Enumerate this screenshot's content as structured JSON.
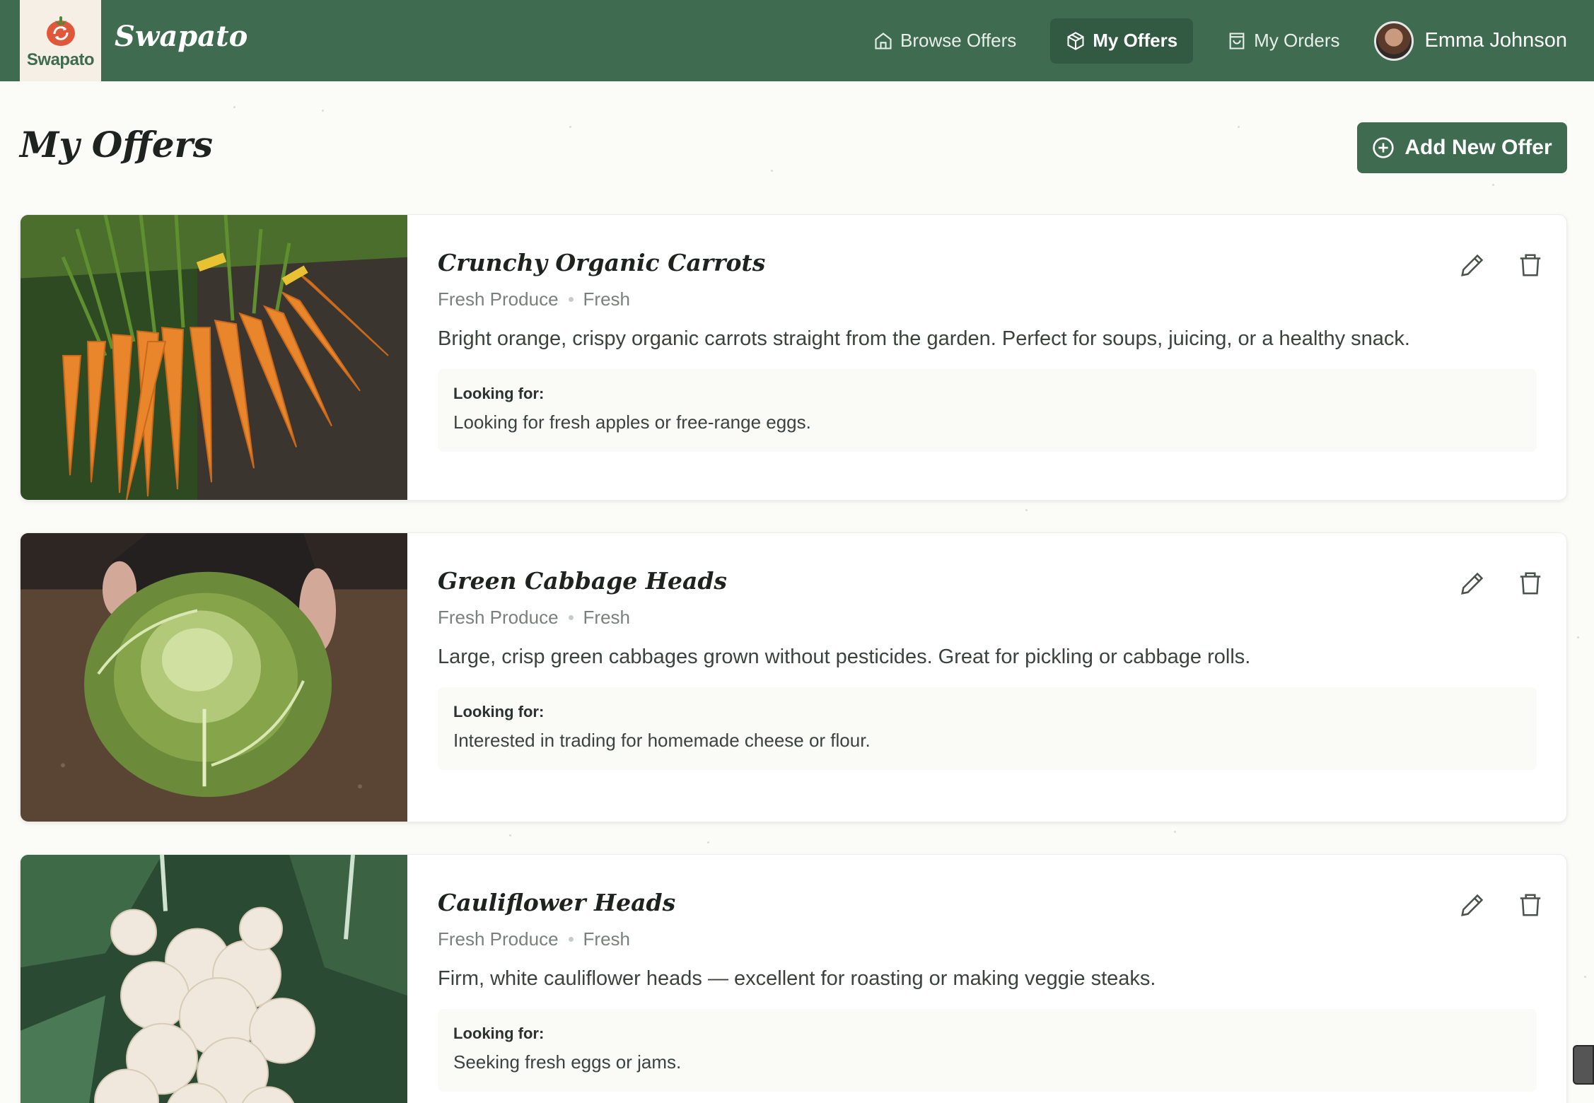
{
  "app": {
    "logo_text": "Swapato",
    "brand": "Swapato"
  },
  "nav": {
    "items": [
      {
        "label": "Browse Offers",
        "icon": "home-icon",
        "active": false
      },
      {
        "label": "My Offers",
        "icon": "package-icon",
        "active": true
      },
      {
        "label": "My Orders",
        "icon": "shopping-bag-icon",
        "active": false
      }
    ],
    "user_name": "Emma Johnson"
  },
  "page": {
    "title": "My Offers",
    "add_button_label": "Add New Offer"
  },
  "offers": [
    {
      "title": "Crunchy Organic Carrots",
      "category": "Fresh Produce",
      "condition": "Fresh",
      "description": "Bright orange, crispy organic carrots straight from the garden. Perfect for soups, juicing, or a healthy snack.",
      "looking_label": "Looking for:",
      "looking_text": "Looking for fresh apples or free-range eggs."
    },
    {
      "title": "Green Cabbage Heads",
      "category": "Fresh Produce",
      "condition": "Fresh",
      "description": "Large, crisp green cabbages grown without pesticides. Great for pickling or cabbage rolls.",
      "looking_label": "Looking for:",
      "looking_text": "Interested in trading for homemade cheese or flour."
    },
    {
      "title": "Cauliflower Heads",
      "category": "Fresh Produce",
      "condition": "Fresh",
      "description": "Firm, white cauliflower heads — excellent for roasting or making veggie steaks.",
      "looking_label": "Looking for:",
      "looking_text": "Seeking fresh eggs or jams."
    }
  ],
  "colors": {
    "primary": "#3f6b51",
    "primary_dark": "#325a43",
    "background": "#fbfbf8"
  }
}
